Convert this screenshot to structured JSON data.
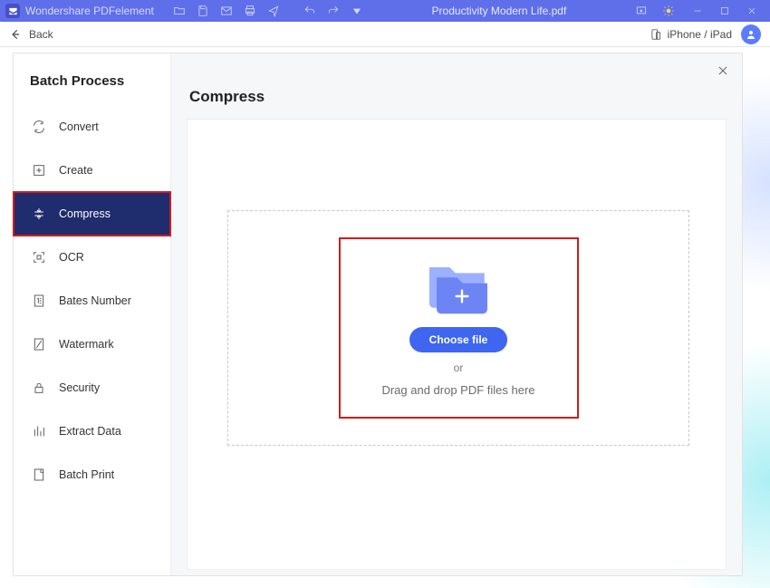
{
  "titlebar": {
    "app_name": "Wondershare PDFelement",
    "document_title": "Productivity Modern Life.pdf"
  },
  "topbar": {
    "back_label": "Back",
    "device_label": "iPhone / iPad"
  },
  "sidebar": {
    "title": "Batch Process",
    "items": [
      {
        "label": "Convert"
      },
      {
        "label": "Create"
      },
      {
        "label": "Compress"
      },
      {
        "label": "OCR"
      },
      {
        "label": "Bates Number"
      },
      {
        "label": "Watermark"
      },
      {
        "label": "Security"
      },
      {
        "label": "Extract Data"
      },
      {
        "label": "Batch Print"
      }
    ],
    "active_index": 2
  },
  "main": {
    "title": "Compress",
    "choose_file_label": "Choose file",
    "or_label": "or",
    "drag_drop_label": "Drag and drop PDF files here"
  },
  "colors": {
    "accent": "#3e66f0",
    "titlebar": "#5f6fe9",
    "sidebar_active": "#1f2c6d",
    "highlight_border": "#d21b1b"
  }
}
